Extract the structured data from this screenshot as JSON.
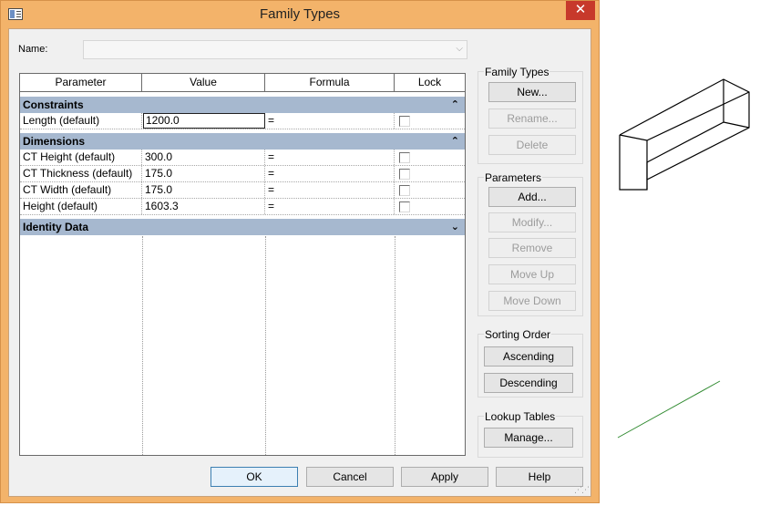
{
  "window": {
    "title": "Family Types",
    "close_glyph": "✕"
  },
  "name_field": {
    "label": "Name:",
    "value": ""
  },
  "table": {
    "headers": [
      "Parameter",
      "Value",
      "Formula",
      "Lock"
    ],
    "groups": [
      {
        "label": "Constraints",
        "collapse_glyph": "⌃",
        "rows": [
          {
            "parameter": "Length (default)",
            "value": "1200.0",
            "formula": "=",
            "locked": false
          }
        ]
      },
      {
        "label": "Dimensions",
        "collapse_glyph": "⌃",
        "rows": [
          {
            "parameter": "CT Height (default)",
            "value": "300.0",
            "formula": "=",
            "locked": false
          },
          {
            "parameter": "CT Thickness (default)",
            "value": "175.0",
            "formula": "=",
            "locked": false
          },
          {
            "parameter": "CT Width (default)",
            "value": "175.0",
            "formula": "=",
            "locked": false
          },
          {
            "parameter": "Height (default)",
            "value": "1603.3",
            "formula": "=",
            "locked": false
          }
        ]
      },
      {
        "label": "Identity Data",
        "collapse_glyph": "⌄",
        "rows": []
      }
    ]
  },
  "family_types": {
    "label": "Family Types",
    "new": "New...",
    "rename": "Rename...",
    "delete": "Delete"
  },
  "parameters": {
    "label": "Parameters",
    "add": "Add...",
    "modify": "Modify...",
    "remove": "Remove",
    "move_up": "Move Up",
    "move_down": "Move Down"
  },
  "sorting": {
    "label": "Sorting Order",
    "ascending": "Ascending",
    "descending": "Descending"
  },
  "lookup": {
    "label": "Lookup Tables",
    "manage": "Manage..."
  },
  "footer": {
    "ok": "OK",
    "cancel": "Cancel",
    "apply": "Apply",
    "help": "Help"
  },
  "colors": {
    "title_bar": "#f3b36a",
    "close_button": "#c7392b",
    "group_header": "#a6b8cf",
    "preview_line": "#2f8a2f"
  }
}
